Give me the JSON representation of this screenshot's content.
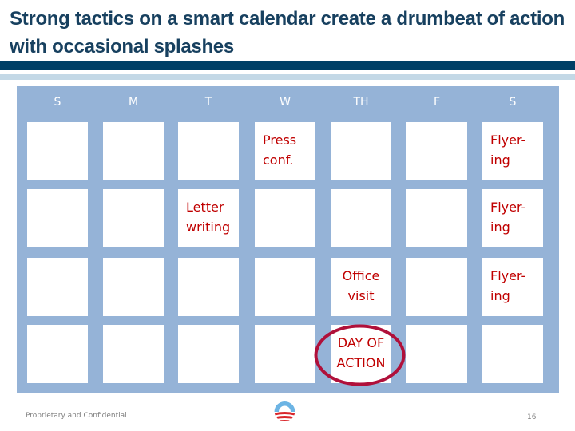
{
  "slide": {
    "title": "Strong tactics on a smart calendar create a drumbeat of action with occasional splashes",
    "footer": "Proprietary and Confidential",
    "page_number": "16",
    "logo_icon": "campaign-logo-icon"
  },
  "colors": {
    "title": "#17405F",
    "accent_bar": "#003F66",
    "calendar_bg": "#95B3D7",
    "event_text": "#C00000",
    "highlight_oval": "#B0103A"
  },
  "calendar": {
    "days": [
      "S",
      "M",
      "T",
      "W",
      "TH",
      "F",
      "S"
    ],
    "weeks": [
      [
        "",
        "",
        "",
        "Press conf.",
        "",
        "",
        "Flyer-ing"
      ],
      [
        "",
        "",
        "Letter writing",
        "",
        "",
        "",
        "Flyer-ing"
      ],
      [
        "",
        "",
        "",
        "",
        "Office visit",
        "",
        "Flyer-ing"
      ],
      [
        "",
        "",
        "",
        "",
        "DAY OF ACTION",
        "",
        ""
      ]
    ],
    "cell_lines": {
      "w0d3": [
        "Press",
        "conf."
      ],
      "w0d6": [
        "Flyer-",
        "ing"
      ],
      "w1d2": [
        "Letter",
        "writing"
      ],
      "w1d6": [
        "Flyer-",
        "ing"
      ],
      "w2d4": [
        "Office",
        "visit"
      ],
      "w2d6": [
        "Flyer-",
        "ing"
      ],
      "w3d4": [
        "DAY OF",
        "ACTION"
      ]
    },
    "highlighted_event": "DAY OF ACTION"
  }
}
